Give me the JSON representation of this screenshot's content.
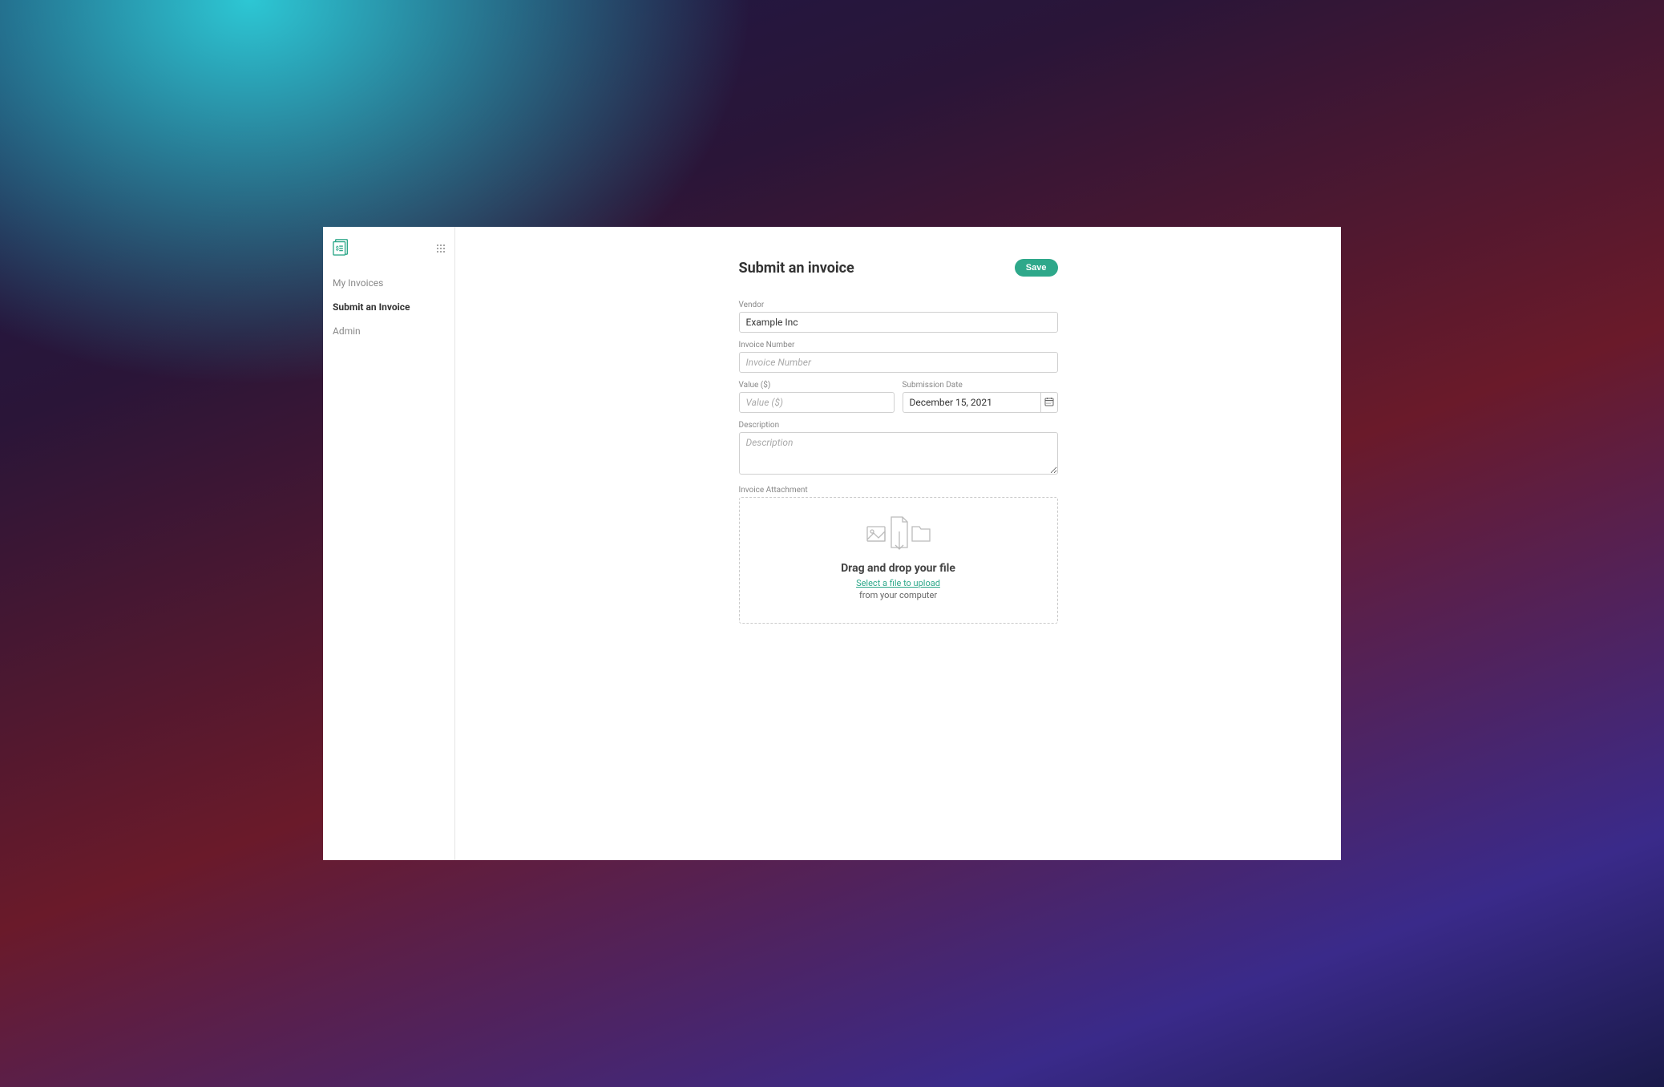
{
  "sidebar": {
    "items": [
      {
        "label": "My Invoices",
        "active": false
      },
      {
        "label": "Submit an Invoice",
        "active": true
      },
      {
        "label": "Admin",
        "active": false
      }
    ]
  },
  "form": {
    "title": "Submit an invoice",
    "save_label": "Save",
    "vendor": {
      "label": "Vendor",
      "value": "Example Inc"
    },
    "invoice_number": {
      "label": "Invoice Number",
      "placeholder": "Invoice Number",
      "value": ""
    },
    "value": {
      "label": "Value ($)",
      "placeholder": "Value ($)",
      "value": ""
    },
    "submission_date": {
      "label": "Submission Date",
      "value": "December 15, 2021"
    },
    "description": {
      "label": "Description",
      "placeholder": "Description",
      "value": ""
    },
    "attachment": {
      "label": "Invoice Attachment",
      "dropzone_title": "Drag and drop your file",
      "dropzone_link": "Select a file to upload",
      "dropzone_sub": "from your computer"
    }
  }
}
